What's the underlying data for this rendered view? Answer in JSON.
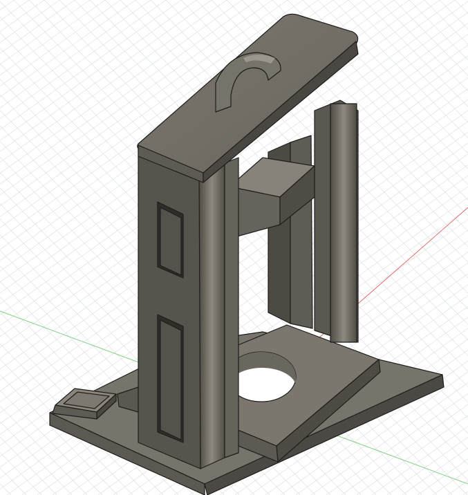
{
  "viewport": {
    "background_color": "#ffffff",
    "grid_color": "#d7dde3",
    "x_axis_color": "#e06b6b",
    "y_axis_color": "#7fd07f"
  },
  "model": {
    "base_color": "#6d6a62",
    "face_light": "#7a766c",
    "face_dark": "#4f4c45",
    "edge_color": "#1e1d1b"
  }
}
